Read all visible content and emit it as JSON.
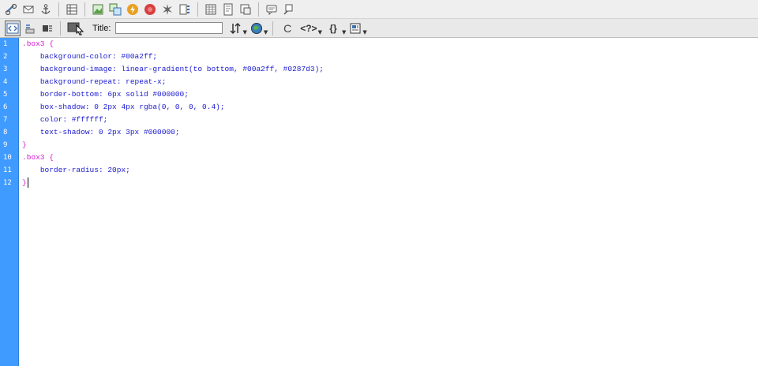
{
  "toolbar_top": {
    "icons": [
      "hyperlink-icon",
      "email-link-icon",
      "named-anchor-icon",
      "table-icon",
      "image-icon",
      "rollover-image-icon",
      "flash-icon",
      "media-icon",
      "date-icon",
      "comment-icon",
      "frames-icon",
      "template-icon",
      "head-content-icon",
      "script-icon",
      "tag-chooser-icon"
    ]
  },
  "toolbar_doc": {
    "title_label": "Title:",
    "title_value": "",
    "glyphs": {
      "refresh": "C",
      "code_nav": "<?>",
      "braces": "{}"
    }
  },
  "editor": {
    "line_numbers": [
      "1",
      "2",
      "3",
      "4",
      "5",
      "6",
      "7",
      "8",
      "9",
      "10",
      "11",
      "12"
    ],
    "lines": [
      {
        "indent": "",
        "selector": ".box3 {",
        "prop": "",
        "value": ""
      },
      {
        "indent": "    ",
        "selector": "",
        "prop": "background-color",
        "value": " #00a2ff;"
      },
      {
        "indent": "    ",
        "selector": "",
        "prop": "background-image",
        "value": " linear-gradient(to bottom, #00a2ff, #0287d3);"
      },
      {
        "indent": "    ",
        "selector": "",
        "prop": "background-repeat",
        "value": " repeat-x;"
      },
      {
        "indent": "    ",
        "selector": "",
        "prop": "border-bottom",
        "value": " 6px solid #000000;"
      },
      {
        "indent": "    ",
        "selector": "",
        "prop": "box-shadow",
        "value": " 0 2px 4px rgba(0, 0, 0, 0.4);"
      },
      {
        "indent": "    ",
        "selector": "",
        "prop": "color",
        "value": " #ffffff;"
      },
      {
        "indent": "    ",
        "selector": "",
        "prop": "text-shadow",
        "value": " 0 2px 3px #000000;"
      },
      {
        "indent": "",
        "selector": "}",
        "prop": "",
        "value": ""
      },
      {
        "indent": "",
        "selector": ".box3 {",
        "prop": "",
        "value": ""
      },
      {
        "indent": "    ",
        "selector": "",
        "prop": "border-radius",
        "value": " 20px;"
      },
      {
        "indent": "",
        "selector": "}",
        "prop": "",
        "value": ""
      }
    ]
  },
  "colors": {
    "gutter": "#3f9bff",
    "selector": "#d21dd0",
    "property": "#1a1ad0"
  }
}
